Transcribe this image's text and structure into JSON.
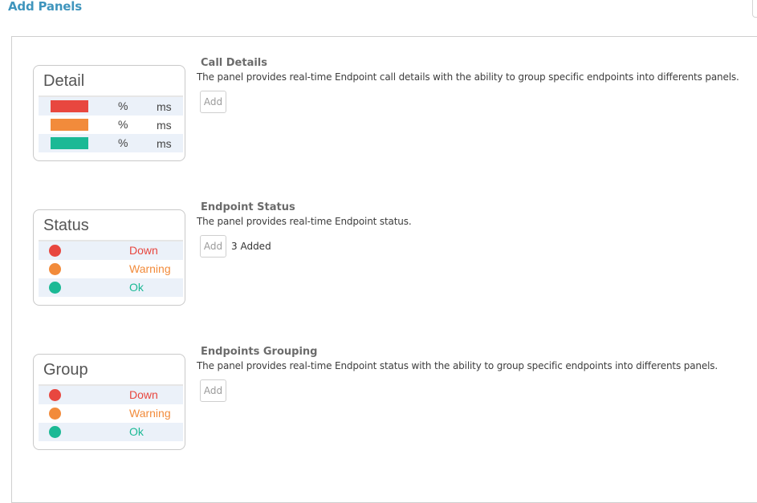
{
  "page_title": "Add Panels",
  "colors": {
    "accent": "#3f95bd",
    "red": "#e8473f",
    "orange": "#f28b3b",
    "green": "#1bb995",
    "row_alt": "#ebf1f9"
  },
  "panels": [
    {
      "preview": {
        "title": "Detail",
        "rows": [
          {
            "swatch_color": "#e8473f",
            "pct_label": "%",
            "ms_label": "ms"
          },
          {
            "swatch_color": "#f28b3b",
            "pct_label": "%",
            "ms_label": "ms"
          },
          {
            "swatch_color": "#1bb995",
            "pct_label": "%",
            "ms_label": "ms"
          }
        ]
      },
      "title": "Call Details",
      "description": "The panel provides real-time Endpoint call details with the ability to group specific endpoints into differents panels.",
      "add_label": "Add",
      "added_text": ""
    },
    {
      "preview": {
        "title": "Status",
        "rows": [
          {
            "dot_color": "#e8473f",
            "label": "Down",
            "label_color": "#e8473f"
          },
          {
            "dot_color": "#f28b3b",
            "label": "Warning",
            "label_color": "#f28b3b"
          },
          {
            "dot_color": "#1bb995",
            "label": "Ok",
            "label_color": "#1bb995"
          }
        ]
      },
      "title": "Endpoint Status",
      "description": "The panel provides real-time Endpoint status.",
      "add_label": "Add",
      "added_text": "3 Added"
    },
    {
      "preview": {
        "title": "Group",
        "rows": [
          {
            "dot_color": "#e8473f",
            "label": "Down",
            "label_color": "#e8473f"
          },
          {
            "dot_color": "#f28b3b",
            "label": "Warning",
            "label_color": "#f28b3b"
          },
          {
            "dot_color": "#1bb995",
            "label": "Ok",
            "label_color": "#1bb995"
          }
        ]
      },
      "title": "Endpoints Grouping",
      "description": "The panel provides real-time Endpoint status with the ability to group specific endpoints into differents panels.",
      "add_label": "Add",
      "added_text": ""
    }
  ]
}
